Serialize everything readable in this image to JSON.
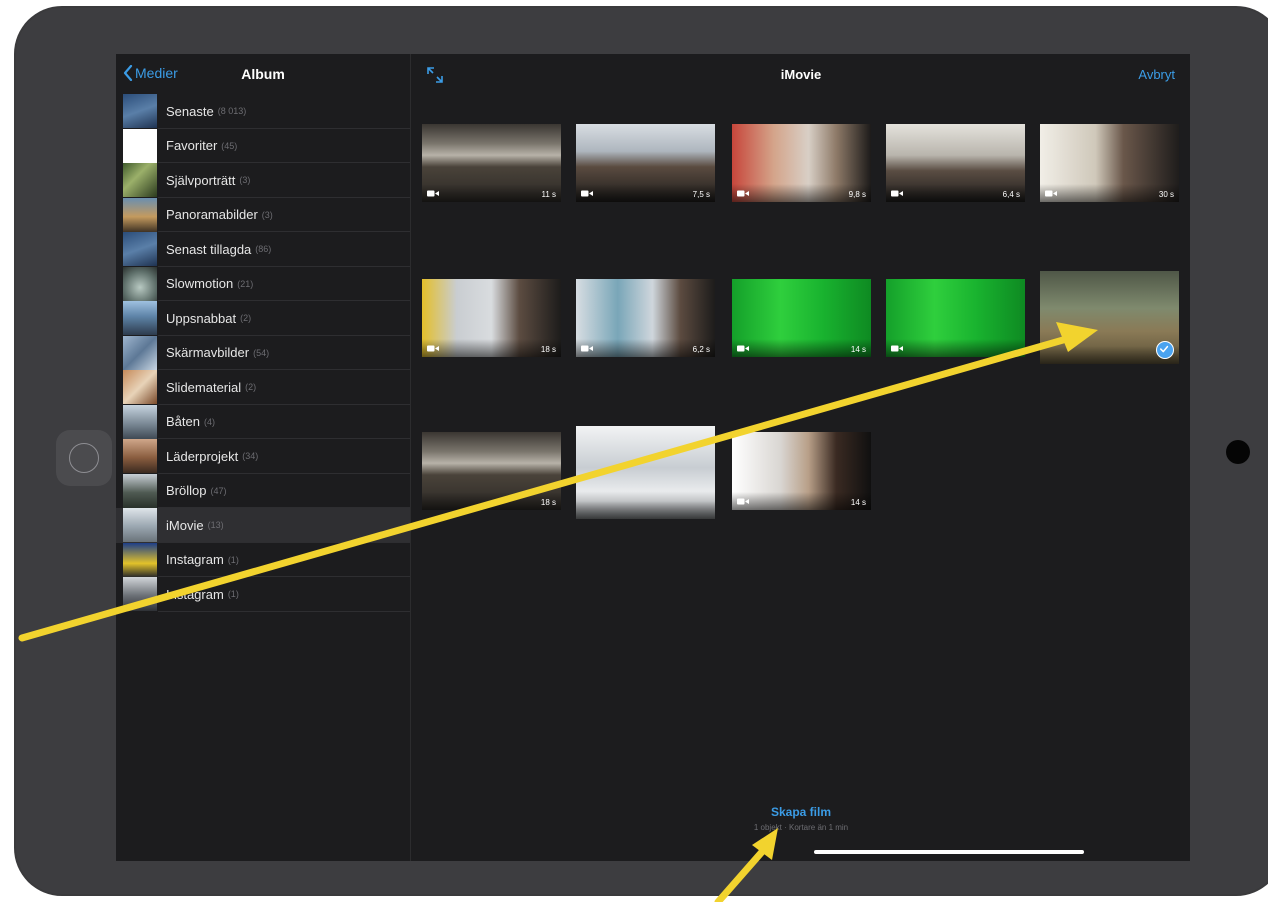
{
  "sidebar": {
    "back_label": "Medier",
    "title": "Album",
    "items": [
      {
        "label": "Senaste",
        "count": "(8 013)"
      },
      {
        "label": "Favoriter",
        "count": "(45)"
      },
      {
        "label": "Självporträtt",
        "count": "(3)"
      },
      {
        "label": "Panoramabilder",
        "count": "(3)"
      },
      {
        "label": "Senast tillagda",
        "count": "(86)"
      },
      {
        "label": "Slowmotion",
        "count": "(21)"
      },
      {
        "label": "Uppsnabbat",
        "count": "(2)"
      },
      {
        "label": "Skärmavbilder",
        "count": "(54)"
      },
      {
        "label": "Slidematerial",
        "count": "(2)"
      },
      {
        "label": "Båten",
        "count": "(4)"
      },
      {
        "label": "Läderprojekt",
        "count": "(34)"
      },
      {
        "label": "Bröllop",
        "count": "(47)"
      },
      {
        "label": "iMovie",
        "count": "(13)"
      },
      {
        "label": "Instagram",
        "count": "(1)"
      },
      {
        "label": "Instagram",
        "count": "(1)"
      }
    ],
    "selected_index": 12
  },
  "main": {
    "title": "iMovie",
    "cancel_label": "Avbryt",
    "create_label": "Skapa film",
    "create_sub": "1 objekt · Kortare än 1 min",
    "thumbnails": [
      {
        "duration": "11 s",
        "video": true
      },
      {
        "duration": "7,5 s",
        "video": true
      },
      {
        "duration": "9,8 s",
        "video": true
      },
      {
        "duration": "6,4 s",
        "video": true
      },
      {
        "duration": "30 s",
        "video": true
      },
      {
        "duration": "18 s",
        "video": true
      },
      {
        "duration": "6,2 s",
        "video": true
      },
      {
        "duration": "14 s",
        "video": true
      },
      {
        "duration": "",
        "video": true
      },
      {
        "duration": "",
        "video": false,
        "selected": true
      },
      {
        "duration": "18 s",
        "video": false
      },
      {
        "duration": "",
        "video": false
      },
      {
        "duration": "14 s",
        "video": true
      }
    ]
  },
  "colors": {
    "accent": "#3b9ce6",
    "arrow": "#f2d32e",
    "background": "#1c1c1e"
  }
}
